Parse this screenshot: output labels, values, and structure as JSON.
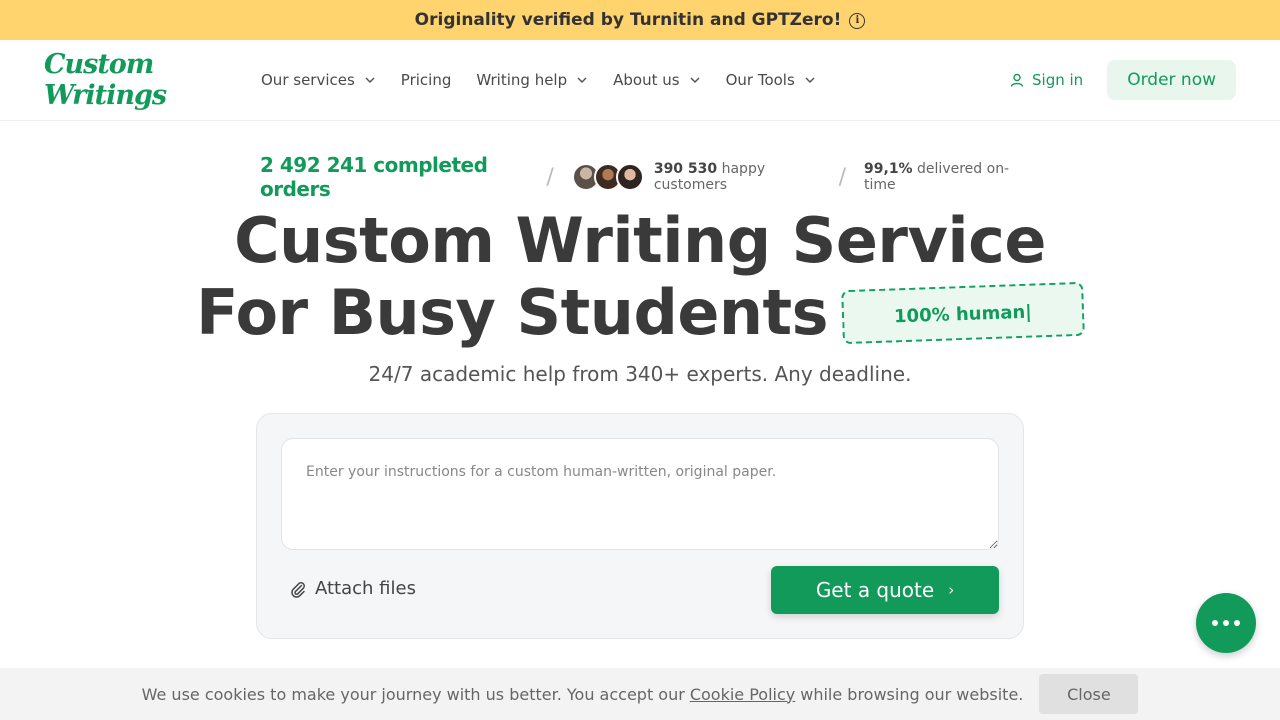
{
  "banner": {
    "text": "Originality verified by Turnitin and GPTZero!",
    "icon": "info-icon"
  },
  "nav": {
    "logo": "Custom Writings",
    "items": [
      {
        "label": "Our services",
        "dropdown": true
      },
      {
        "label": "Pricing",
        "dropdown": false
      },
      {
        "label": "Writing help",
        "dropdown": true
      },
      {
        "label": "About us",
        "dropdown": true
      },
      {
        "label": "Our Tools",
        "dropdown": true
      }
    ],
    "signin_label": "Sign in",
    "order_label": "Order now"
  },
  "stats": {
    "orders": "2 492 241 completed orders",
    "customers_count": "390 530",
    "customers_label": "happy customers",
    "ontime_value": "99,1%",
    "ontime_label": "delivered on-time"
  },
  "hero": {
    "title_line1": "Custom Writing Service",
    "title_line2": "For Busy Students",
    "badge": "100% human|",
    "subtitle": "24/7 academic help from 340+ experts. Any deadline."
  },
  "quote": {
    "placeholder": "Enter your instructions for a custom human-written, original paper.",
    "attach_label": "Attach files",
    "button_label": "Get a quote",
    "button_arrow": "›"
  },
  "cookie": {
    "text_before": "We use cookies to make your journey with us better. You accept our",
    "link": "Cookie Policy",
    "text_after": "while browsing our website.",
    "close_label": "Close"
  },
  "colors": {
    "brand": "#129a5b",
    "banner": "#ffd36e",
    "brand_light": "#e8f6ee"
  }
}
